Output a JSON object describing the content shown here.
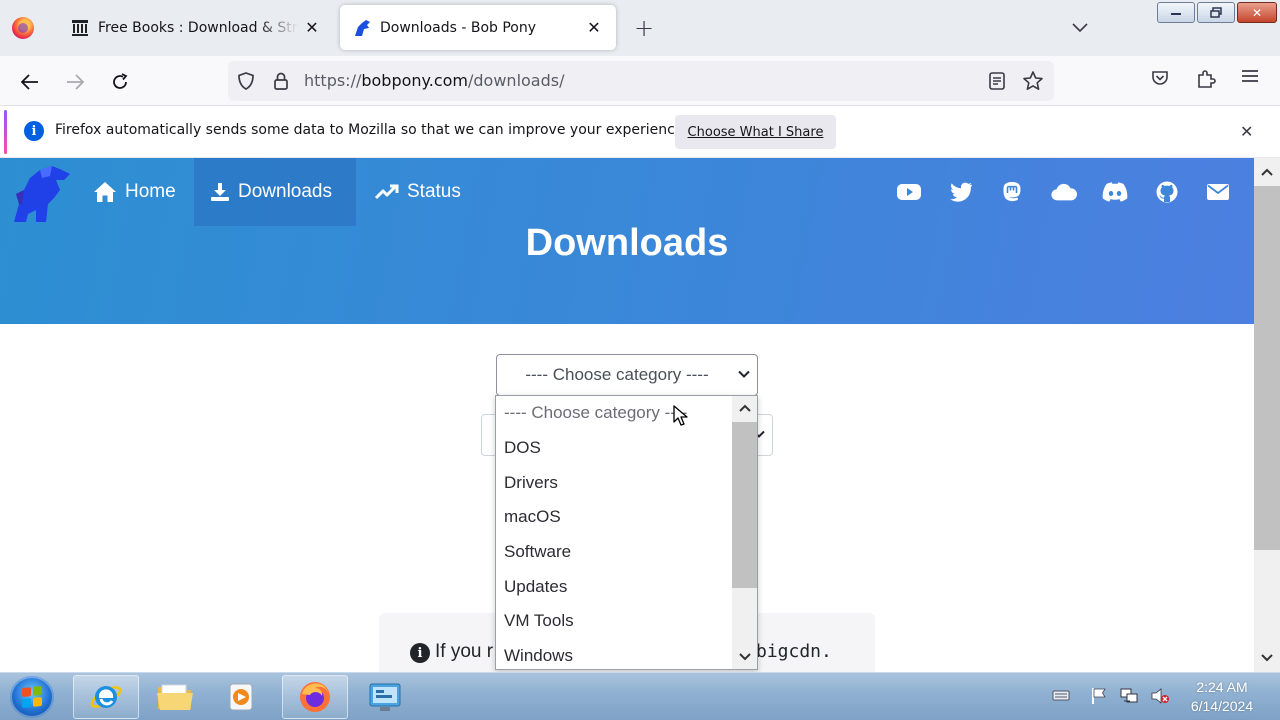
{
  "browser": {
    "tabs": [
      {
        "title": "Free Books : Download & Streaming : Internet Archive",
        "active": false,
        "favicon": "archive-icon"
      },
      {
        "title": "Downloads - Bob Pony",
        "active": true,
        "favicon": "bobpony-icon"
      }
    ],
    "url_prefix": "https://",
    "url_host": "bobpony.com",
    "url_path": "/downloads/"
  },
  "notification": {
    "message": "Firefox automatically sends some data to Mozilla so that we can improve your experience.",
    "button_label": "Choose What I Share"
  },
  "site": {
    "nav": [
      {
        "label": "Home",
        "icon": "home-icon"
      },
      {
        "label": "Downloads",
        "icon": "download-icon",
        "active": true
      },
      {
        "label": "Status",
        "icon": "trending-icon"
      }
    ],
    "socials": [
      "youtube-icon",
      "twitter-icon",
      "mastodon-icon",
      "cloud-icon",
      "discord-icon",
      "github-icon",
      "email-icon"
    ],
    "page_title": "Downloads",
    "select_value": "---- Choose category ----",
    "dropdown_options": [
      "---- Choose category ----",
      "DOS",
      "Drivers",
      "macOS",
      "Software",
      "Updates",
      "VM Tools",
      "Windows"
    ],
    "notice_text_start": "If you r",
    "notice_text_end": "bigcdn."
  },
  "taskbar": {
    "time": "2:24 AM",
    "date": "6/14/2024"
  },
  "colors": {
    "hero": "#3d86da",
    "firefox_accent": "#0060df"
  }
}
